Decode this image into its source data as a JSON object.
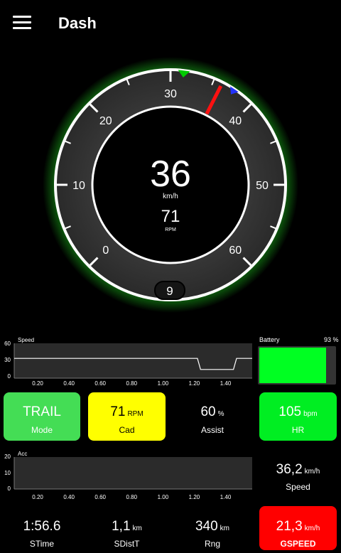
{
  "header": {
    "title": "Dash",
    "menu_icon": "hamburger-menu-icon"
  },
  "gauge": {
    "speed": "36",
    "speed_unit": "km/h",
    "rpm": "71",
    "rpm_unit": "RPM",
    "gear": "9",
    "scale_labels": [
      "0",
      "10",
      "20",
      "30",
      "40",
      "50",
      "60"
    ],
    "min": 0,
    "max": 60,
    "needle_value": 36,
    "target_marker_value": 31.5,
    "max_marker_value": 37.5,
    "colors": {
      "glow": "#22ee22",
      "needle": "#ff1111",
      "target": "#00cc00",
      "max_marker": "#2233ff"
    }
  },
  "speed_chart": {
    "title": "Speed",
    "y_ticks": [
      "60",
      "30",
      "0"
    ],
    "x_ticks": [
      "0.20",
      "0.40",
      "0.60",
      "0.80",
      "1.00",
      "1.20",
      "1.40"
    ]
  },
  "acc_chart": {
    "title": "Acc",
    "y_ticks": [
      "20",
      "10",
      "0"
    ],
    "x_ticks": [
      "0.20",
      "0.40",
      "0.60",
      "0.80",
      "1.00",
      "1.20",
      "1.40"
    ]
  },
  "chart_data": [
    {
      "type": "line",
      "title": "Speed",
      "x": [
        0.05,
        0.45,
        0.6,
        1.22,
        1.24,
        1.45,
        1.47,
        1.57
      ],
      "y": [
        34,
        34,
        34,
        34,
        15,
        15,
        34,
        34
      ],
      "xlim": [
        0.05,
        1.57
      ],
      "ylim": [
        0,
        60
      ],
      "grid": false
    },
    {
      "type": "line",
      "title": "Acc",
      "x": [],
      "y": [],
      "xlim": [
        0.05,
        1.57
      ],
      "ylim": [
        0,
        20
      ],
      "grid": false
    }
  ],
  "battery": {
    "label": "Battery",
    "percent_text": "93 %",
    "level": 0.93,
    "color": "#00ff22"
  },
  "tiles": {
    "mode": {
      "value": "TRAIL",
      "label": "Mode",
      "color": "#44dd55"
    },
    "cad": {
      "value": "71",
      "unit": "RPM",
      "label": "Cad",
      "color": "#ffff00"
    },
    "assist": {
      "value": "60",
      "unit": "%",
      "label": "Assist"
    },
    "hr": {
      "value": "105",
      "unit": "bpm",
      "label": "HR",
      "color": "#00ee22"
    },
    "speed": {
      "value": "36,2",
      "unit": "km/h",
      "label": "Speed"
    },
    "stime": {
      "value": "1:56.6",
      "label": "STime"
    },
    "sdist": {
      "value": "1,1",
      "unit": "km",
      "label": "SDistT"
    },
    "rng": {
      "value": "340",
      "unit": "km",
      "label": "Rng"
    },
    "gspeed": {
      "value": "21,3",
      "unit": "km/h",
      "label": "GSPEED",
      "color": "#ff0000"
    }
  }
}
